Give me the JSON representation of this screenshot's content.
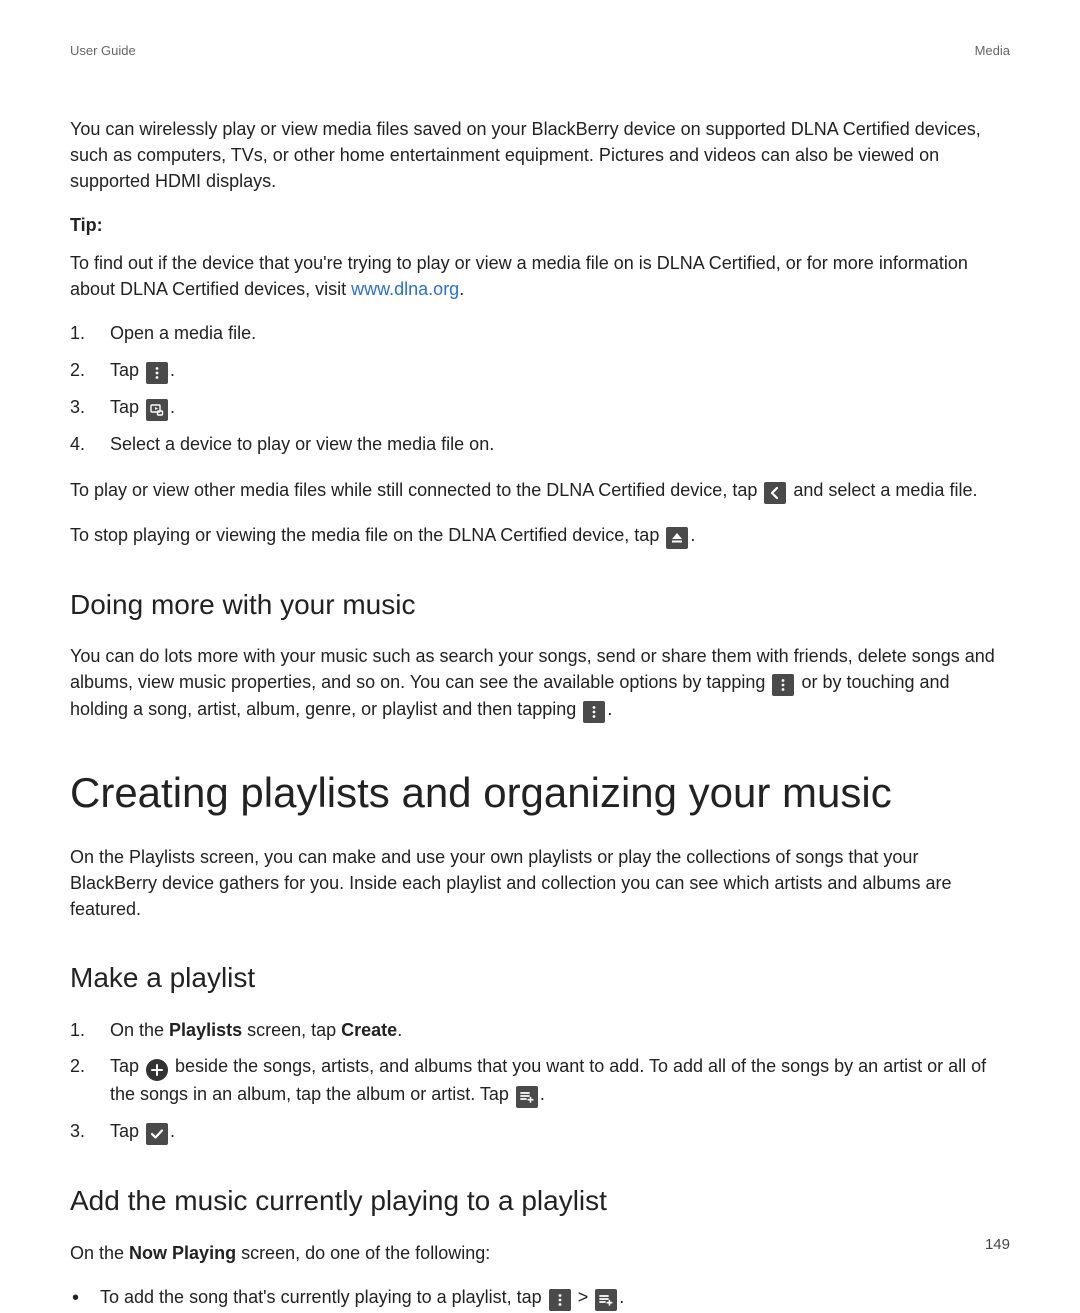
{
  "header": {
    "left": "User Guide",
    "right": "Media"
  },
  "intro": {
    "p1": "You can wirelessly play or view media files saved on your BlackBerry device on supported DLNA Certified devices, such as computers, TVs, or other home entertainment equipment. Pictures and videos can also be viewed on supported HDMI displays.",
    "tip_label": "Tip:",
    "tip_before": "To find out if the device that you're trying to play or view a media file on is DLNA Certified, or for more information about DLNA Certified devices, visit ",
    "tip_link": "www.dlna.org",
    "tip_after": "."
  },
  "steps_a": {
    "s1": "Open a media file.",
    "s2_before": "Tap ",
    "s2_after": ".",
    "s3_before": "Tap ",
    "s3_after": ".",
    "s4": "Select a device to play or view the media file on."
  },
  "para_b": {
    "p1_before": "To play or view other media files while still connected to the DLNA Certified device, tap ",
    "p1_after": " and select a media file.",
    "p2_before": "To stop playing or viewing the media file on the DLNA Certified device, tap ",
    "p2_after": "."
  },
  "doing_more": {
    "heading": "Doing more with your music",
    "p_before": "You can do lots more with your music such as search your songs, send or share them with friends, delete songs and albums, view music properties, and so on. You can see the available options by tapping ",
    "p_mid": " or by touching and holding a song, artist, album, genre, or playlist and then tapping ",
    "p_after": "."
  },
  "creating": {
    "heading": "Creating playlists and organizing your music",
    "p": "On the Playlists screen, you can make and use your own playlists or play the collections of songs that your BlackBerry device gathers for you. Inside each playlist and collection you can see which artists and albums are featured."
  },
  "make_playlist": {
    "heading": "Make a playlist",
    "s1_a": "On the ",
    "s1_b": "Playlists",
    "s1_c": " screen, tap ",
    "s1_d": "Create",
    "s1_e": ".",
    "s2_before": "Tap ",
    "s2_mid": " beside the songs, artists, and albums that you want to add. To add all of the songs by an artist or all of the songs in an album, tap the album or artist. Tap ",
    "s2_after": ".",
    "s3_before": "Tap ",
    "s3_after": "."
  },
  "add_current": {
    "heading": "Add the music currently playing to a playlist",
    "p_a": "On the ",
    "p_b": "Now Playing",
    "p_c": " screen, do one of the following:",
    "li_before": "To add the song that's currently playing to a playlist, tap ",
    "li_mid": " > ",
    "li_after": "."
  },
  "page_number": "149"
}
